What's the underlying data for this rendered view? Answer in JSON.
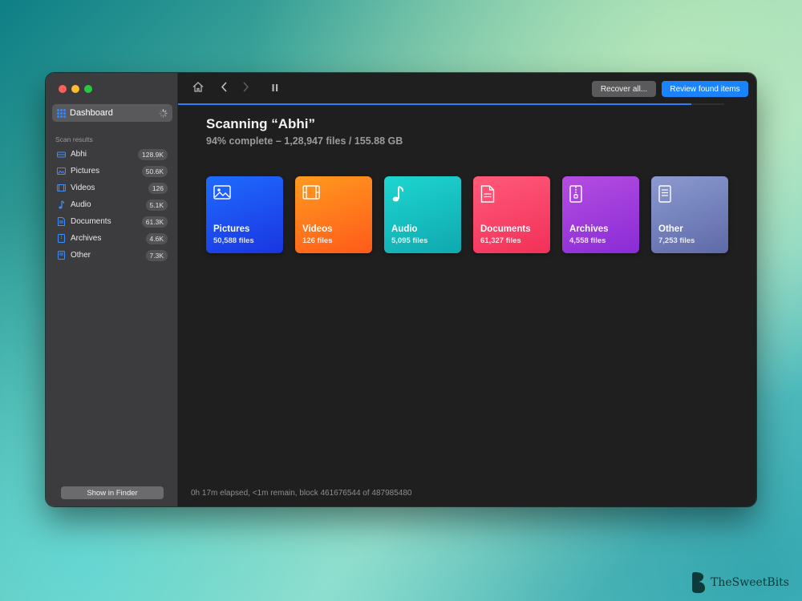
{
  "sidebar": {
    "dashboard_label": "Dashboard",
    "section_label": "Scan results",
    "items": [
      {
        "label": "Abhi",
        "count": "128.9K",
        "icon": "drive-icon"
      },
      {
        "label": "Pictures",
        "count": "50.6K",
        "icon": "picture-icon"
      },
      {
        "label": "Videos",
        "count": "126",
        "icon": "film-icon"
      },
      {
        "label": "Audio",
        "count": "5.1K",
        "icon": "music-note-icon"
      },
      {
        "label": "Documents",
        "count": "61.3K",
        "icon": "document-icon"
      },
      {
        "label": "Archives",
        "count": "4.6K",
        "icon": "archive-icon"
      },
      {
        "label": "Other",
        "count": "7.3K",
        "icon": "file-icon"
      }
    ],
    "finder_button": "Show in Finder"
  },
  "toolbar": {
    "recover_label": "Recover all...",
    "review_label": "Review found items"
  },
  "scan": {
    "title": "Scanning “Abhi”",
    "subtitle": "94% complete – 1,28,947 files / 155.88 GB",
    "progress": 0.94
  },
  "cards": [
    {
      "name": "Pictures",
      "count": "50,588 files",
      "icon": "picture-icon",
      "color_from": "#1f6bff",
      "color_to": "#1a35e0"
    },
    {
      "name": "Videos",
      "count": "126 files",
      "icon": "film-icon",
      "color_from": "#ff9a1f",
      "color_to": "#ff5a1a"
    },
    {
      "name": "Audio",
      "count": "5,095 files",
      "icon": "music-note-icon",
      "color_from": "#1ed6d0",
      "color_to": "#0fa8b0"
    },
    {
      "name": "Documents",
      "count": "61,327 files",
      "icon": "document-icon",
      "color_from": "#ff5a7a",
      "color_to": "#f23058"
    },
    {
      "name": "Archives",
      "count": "4,558 files",
      "icon": "archive-icon",
      "color_from": "#b44de0",
      "color_to": "#8a2bd6"
    },
    {
      "name": "Other",
      "count": "7,253 files",
      "icon": "file-icon",
      "color_from": "#8c9ad0",
      "color_to": "#5d6aa8"
    }
  ],
  "status": {
    "text": "0h 17m elapsed, <1m remain, block 461676544 of 487985480"
  },
  "watermark": {
    "text": "TheSweetBits"
  },
  "colors": {
    "accent": "#1a84ff",
    "sidebar_bg": "#3c3c3e",
    "main_bg": "#1f1f1f"
  }
}
